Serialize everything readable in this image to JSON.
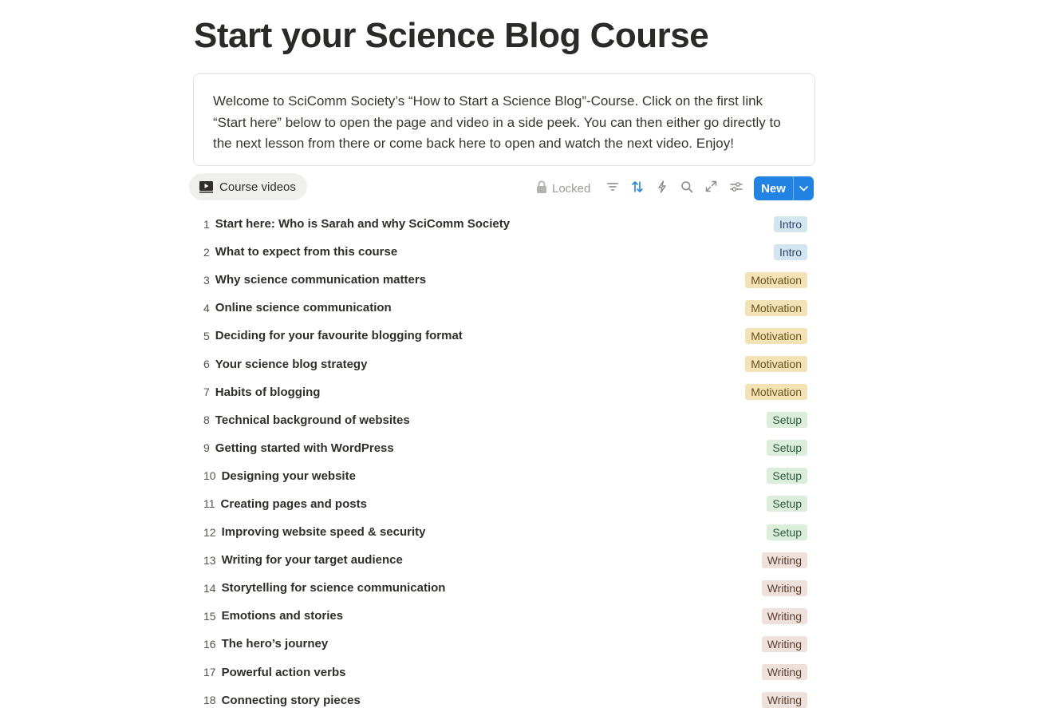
{
  "page": {
    "title": "Start your Science Blog Course",
    "callout": "Welcome to SciComm Society’s “How to Start a Science Blog”-Course. Click on the first link “Start here” below to open the page and video in a side peek. You can then either go directly to the next lesson from there or come back here to open and watch the next video. Enjoy!"
  },
  "view": {
    "tab_label": "Course videos",
    "tab_icon": "video-icon"
  },
  "toolbar": {
    "locked_label": "Locked",
    "icons": [
      "lock-icon",
      "filter-icon",
      "sort-icon",
      "automation-icon",
      "search-icon",
      "expand-icon",
      "settings-icon"
    ],
    "sort_active_color": "#2383e2",
    "new_label": "New"
  },
  "tag_styles": {
    "Intro": {
      "bg": "#d3e5ef",
      "fg": "#28456c"
    },
    "Motivation": {
      "bg": "#f2e2b5",
      "fg": "#6b5318"
    },
    "Setup": {
      "bg": "#dbeddb",
      "fg": "#2b593f"
    },
    "Writing": {
      "bg": "#eee0da",
      "fg": "#5c3b2c"
    }
  },
  "rows": [
    {
      "num": "1",
      "title": "Start here: Who is Sarah and why SciComm Society",
      "tag": "Intro"
    },
    {
      "num": "2",
      "title": "What to expect from this course",
      "tag": "Intro"
    },
    {
      "num": "3",
      "title": "Why science communication matters",
      "tag": "Motivation"
    },
    {
      "num": "4",
      "title": "Online science communication",
      "tag": "Motivation"
    },
    {
      "num": "5",
      "title": "Deciding for your favourite blogging format",
      "tag": "Motivation"
    },
    {
      "num": "6",
      "title": "Your science blog strategy",
      "tag": "Motivation"
    },
    {
      "num": "7",
      "title": "Habits of blogging",
      "tag": "Motivation"
    },
    {
      "num": "8",
      "title": "Technical background of websites",
      "tag": "Setup"
    },
    {
      "num": "9",
      "title": "Getting started with WordPress",
      "tag": "Setup"
    },
    {
      "num": "10",
      "title": "Designing your website",
      "tag": "Setup"
    },
    {
      "num": "11",
      "title": "Creating pages and posts",
      "tag": "Setup"
    },
    {
      "num": "12",
      "title": "Improving website speed & security",
      "tag": "Setup"
    },
    {
      "num": "13",
      "title": "Writing for your target audience",
      "tag": "Writing"
    },
    {
      "num": "14",
      "title": "Storytelling for science communication",
      "tag": "Writing"
    },
    {
      "num": "15",
      "title": "Emotions and stories",
      "tag": "Writing"
    },
    {
      "num": "16",
      "title": "The hero’s journey",
      "tag": "Writing"
    },
    {
      "num": "17",
      "title": "Powerful action verbs",
      "tag": "Writing"
    },
    {
      "num": "18",
      "title": "Connecting story pieces",
      "tag": "Writing"
    }
  ]
}
